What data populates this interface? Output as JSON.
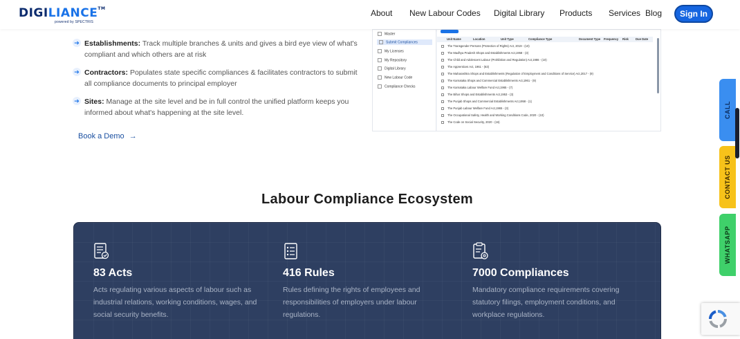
{
  "brand": {
    "name_part1": "DIGI",
    "name_part2": "LIANCE",
    "trademark": "TM",
    "tagline": "powered by SPECTRIS"
  },
  "nav": {
    "items": [
      "About",
      "New Labour Codes",
      "Digital Library",
      "Products",
      "Services",
      "Blog"
    ],
    "signin_label": "Sign In"
  },
  "features": [
    {
      "title": "Establishments:",
      "text": "Track multiple branches & units and gives a bird eye view of what's compliant and which others are at risk"
    },
    {
      "title": "Contractors:",
      "text": "Populates state specific compliances & facilitates contractors to submit all compliance documents to principal employer"
    },
    {
      "title": "Sites:",
      "text": "Manage at the site level and be in full control the unified platform keeps you informed about what's happening at the site level."
    }
  ],
  "book_demo": {
    "label": "Book a Demo",
    "icon": "arrow-right-icon"
  },
  "app_preview": {
    "sidebar": [
      "Master",
      "Submit Compliances",
      "My Licenses",
      "My Repository",
      "Digital Library",
      "New Labour Code",
      "Compliance Checks"
    ],
    "active_sidebar": "Submit Compliances",
    "columns": [
      "Unit Name",
      "Location",
      "Unit Type",
      "Compliance Type",
      "Document Type",
      "Frequency",
      "Risk",
      "Due Date"
    ],
    "rows": [
      "The Transgender Persons (Protection of Rights) Act, 2019 - (10)",
      "The Madhya Pradesh Shops and Establishments Act,1958 - (3)",
      "The Child and Adolescent Labour (Prohibition and Regulation) Act,1986 - (10)",
      "The Apprentices Act, 1961 - (63)",
      "The Maharashtra Shops and Establishments (Regulation of Employment and Conditions of Service) Act,2017 - (9)",
      "The Karnataka Shops and Commercial Establishments Act,1961 - (9)",
      "The Karnataka Labour Welfare Fund Act,1965 - (7)",
      "The Bihar Shops and Establishments Act,1953 - (3)",
      "The Punjab Shops and Commercial Establishments Act,1958 - (1)",
      "The Punjab Labour Welfare Fund Act,1965 - (3)",
      "The Occupational Safety, Health and Working Conditions Code, 2020 - (10)",
      "The Code on Social Security, 2020 - (16)"
    ]
  },
  "ecosystem": {
    "title": "Labour Compliance Ecosystem",
    "stats": [
      {
        "icon": "acts-document-icon",
        "title": "83 Acts",
        "desc": "Acts regulating various aspects of labour such as industrial relations, working conditions, wages, and social security benefits."
      },
      {
        "icon": "rules-list-icon",
        "title": "416 Rules",
        "desc": "Rules defining the rights of employees and responsibilities of employers under labour regulations."
      },
      {
        "icon": "compliance-checklist-icon",
        "title": "7000 Compliances",
        "desc": "Mandatory compliance requirements covering statutory filings, employment conditions, and workplace regulations."
      }
    ]
  },
  "side_tabs": [
    {
      "label": "CALL",
      "color": "#3a8ef0",
      "text_color": "#0b2a5a"
    },
    {
      "label": "CONTACT US",
      "color": "#f7c21a",
      "text_color": "#3b2a00"
    },
    {
      "label": "WHATSAPP",
      "color": "#3fd06a",
      "text_color": "#0b3a18"
    }
  ],
  "colors": {
    "brand_blue": "#1565e0",
    "panel_bg": "#2e3f61",
    "link_blue": "#1a4fa0"
  }
}
